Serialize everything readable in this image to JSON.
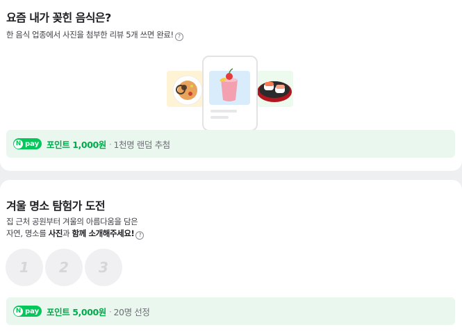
{
  "mission1": {
    "title": "요즘 내가 꽂힌 음식은?",
    "desc": "한 음식 업종에서 사진을 첨부한 리뷰 5개 쓰면 완료!",
    "help_icon": "question-circle-icon",
    "reward": {
      "badge": "pay",
      "badge_n": "N",
      "label": "포인트 1,000원",
      "sep": "·",
      "note": "1천명 랜덤 추첨"
    }
  },
  "mission2": {
    "title": "겨울 명소 탐험가 도전",
    "desc_line1": "집 근처 공원부터 겨울의 아름다움을 담은",
    "desc_line2_plain": "자연, 명소를 ",
    "desc_line2_bold1": "사진",
    "desc_line2_mid": "과 ",
    "desc_line2_bold2": "함께 소개해주세요!",
    "help_icon": "question-circle-icon",
    "steps": [
      "1",
      "2",
      "3"
    ],
    "reward": {
      "badge": "pay",
      "badge_n": "N",
      "label": "포인트 5,000원",
      "sep": "·",
      "note": "20명 선정"
    }
  },
  "colors": {
    "accent_green": "#03c75a",
    "reward_bg": "#eaf7ee",
    "page_bg": "#eeeff1"
  }
}
